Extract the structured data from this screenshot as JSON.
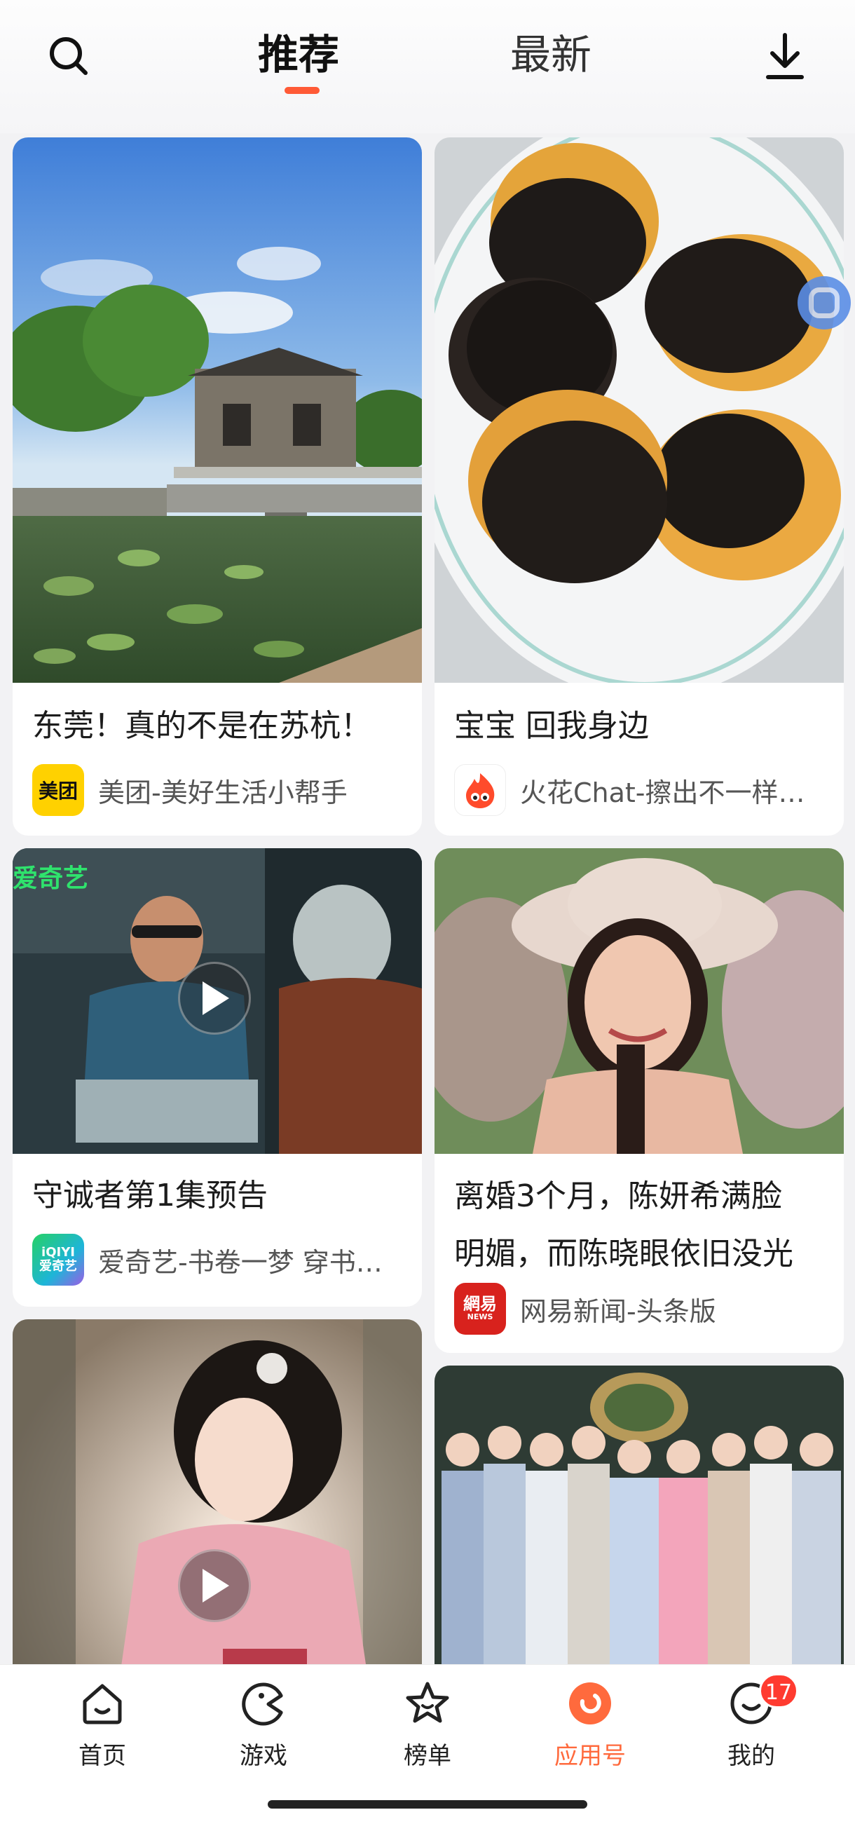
{
  "header": {
    "tabs": [
      {
        "label": "推荐",
        "active": true
      },
      {
        "label": "最新",
        "active": false
      }
    ],
    "search_icon": "search-icon",
    "download_icon": "download-icon",
    "accent_color": "#ff5a36"
  },
  "feed": [
    {
      "title": "东莞！真的不是在苏杭！",
      "source": "美团-美好生活小帮手",
      "logo_text": "美团",
      "logo_color": "#ffd100",
      "media": "photo",
      "video": false
    },
    {
      "title": "宝宝 回我身边",
      "source": "火花Chat-擦出不一样…",
      "logo_text": "",
      "logo_color": "#ff4b2b",
      "media": "photo",
      "video": false
    },
    {
      "title": "守诚者第1集预告",
      "source": "爱奇艺-书卷一梦 穿书…",
      "logo_text": "iQIYI 爱奇艺",
      "logo_color": "#1fd06b",
      "thumb_overlay_text": "爱奇艺",
      "media": "video",
      "video": true
    },
    {
      "title_lines": [
        "离婚3个月，陈妍希满脸",
        "明媚，而陈晓眼依旧没光"
      ],
      "source": "网易新闻-头条版",
      "logo_text": "網易",
      "logo_sub": "NEWS",
      "logo_color": "#d8221d",
      "media": "photo",
      "video": false
    },
    {
      "title": "",
      "source": "",
      "media": "video",
      "video": true
    },
    {
      "title": "",
      "source": "",
      "media": "photo",
      "video": false
    }
  ],
  "bottom_nav": [
    {
      "label": "首页",
      "icon": "home-icon",
      "active": false
    },
    {
      "label": "游戏",
      "icon": "game-icon",
      "active": false
    },
    {
      "label": "榜单",
      "icon": "star-icon",
      "active": false
    },
    {
      "label": "应用号",
      "icon": "app-account-icon",
      "active": true
    },
    {
      "label": "我的",
      "icon": "profile-icon",
      "active": false,
      "badge": "17"
    }
  ],
  "active_color": "#ff6a3d"
}
